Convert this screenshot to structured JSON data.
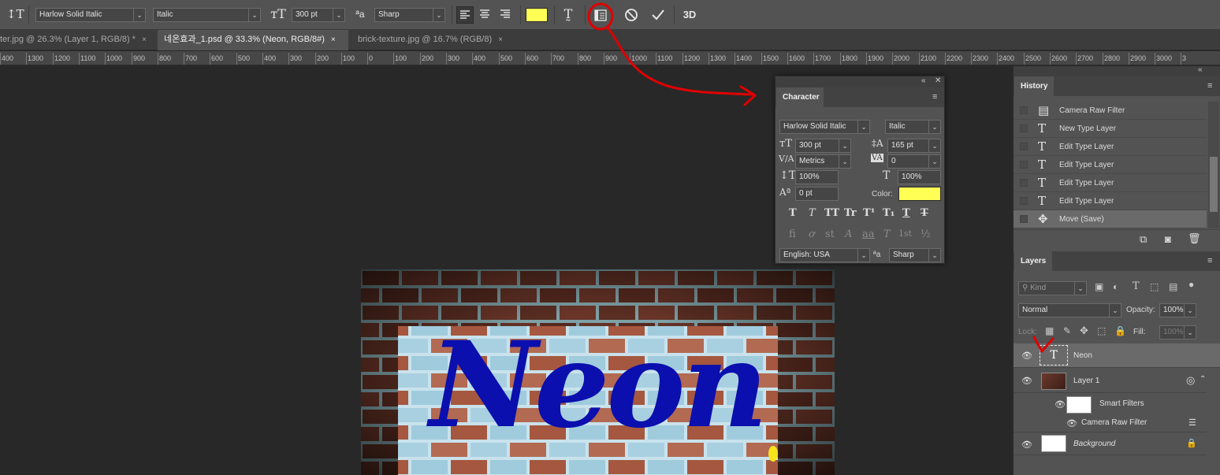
{
  "options_bar": {
    "tool_icon": "type-tool-orientation-icon",
    "font_family": "Harlow Solid Italic",
    "font_style": "Italic",
    "font_size": "300 pt",
    "aa_label": "a",
    "antialias": "Sharp",
    "text_color": "#ffff55",
    "mode_3d": "3D"
  },
  "tabs": [
    {
      "label": "ter.jpg @ 26.3% (Layer 1, RGB/8) *",
      "close": "×"
    },
    {
      "label": "네온효과_1.psd @ 33.3% (Neon, RGB/8#)",
      "close": "×"
    },
    {
      "label": "brick-texture.jpg @ 16.7% (RGB/8)",
      "close": "×"
    }
  ],
  "ruler": {
    "ticks": [
      "400",
      "1300",
      "1200",
      "1100",
      "1000",
      "900",
      "800",
      "700",
      "600",
      "500",
      "400",
      "300",
      "200",
      "100",
      "0",
      "100",
      "200",
      "300",
      "400",
      "500",
      "600",
      "700",
      "800",
      "900",
      "1000",
      "1100",
      "1200",
      "1300",
      "1400",
      "1500",
      "1600",
      "1700",
      "1800",
      "1900",
      "2000",
      "2100",
      "2200",
      "2300",
      "2400",
      "2500",
      "2600",
      "2700",
      "2800",
      "2900",
      "3000",
      "3"
    ]
  },
  "canvas": {
    "neon_text": "Neon",
    "text_color": "#0a0fae",
    "brick_color": "#4a2820",
    "panel_color": "#9ec6d6"
  },
  "character": {
    "title": "Character",
    "font_family": "Harlow Solid Italic",
    "font_style": "Italic",
    "size": "300 pt",
    "leading": "165 pt",
    "kerning": "Metrics",
    "tracking": "0",
    "vscale": "100%",
    "hscale": "100%",
    "baseline": "0 pt",
    "color_label": "Color:",
    "color": "#ffff55",
    "language": "English: USA",
    "aa_label": "a",
    "antialias": "Sharp",
    "fmt_buttons": [
      "T",
      "T",
      "TT",
      "Tr",
      "T¹",
      "T₁",
      "T",
      "T"
    ],
    "ot_buttons": [
      "fi",
      "ơ",
      "st",
      "A",
      "aa",
      "T",
      "1st",
      "½"
    ]
  },
  "history": {
    "title": "History",
    "items": [
      {
        "icon": "document-icon",
        "label": "Camera Raw Filter"
      },
      {
        "icon": "type-icon",
        "label": "New Type Layer"
      },
      {
        "icon": "type-icon",
        "label": "Edit Type Layer"
      },
      {
        "icon": "type-icon",
        "label": "Edit Type Layer"
      },
      {
        "icon": "type-icon",
        "label": "Edit Type Layer"
      },
      {
        "icon": "type-icon",
        "label": "Edit Type Layer"
      },
      {
        "icon": "move-icon",
        "label": "Move (Save)"
      }
    ]
  },
  "layers": {
    "title": "Layers",
    "filter_placeholder": "Kind",
    "blend_mode": "Normal",
    "opacity_label": "Opacity:",
    "opacity": "100%",
    "lock_label": "Lock:",
    "fill_label": "Fill:",
    "fill": "100%",
    "rows": [
      {
        "name": "Neon",
        "type": "text"
      },
      {
        "name": "Layer 1",
        "type": "smart"
      },
      {
        "name": "Smart Filters",
        "type": "filters"
      },
      {
        "name": "Camera Raw Filter",
        "type": "filter"
      },
      {
        "name": "Background",
        "type": "background"
      }
    ]
  }
}
